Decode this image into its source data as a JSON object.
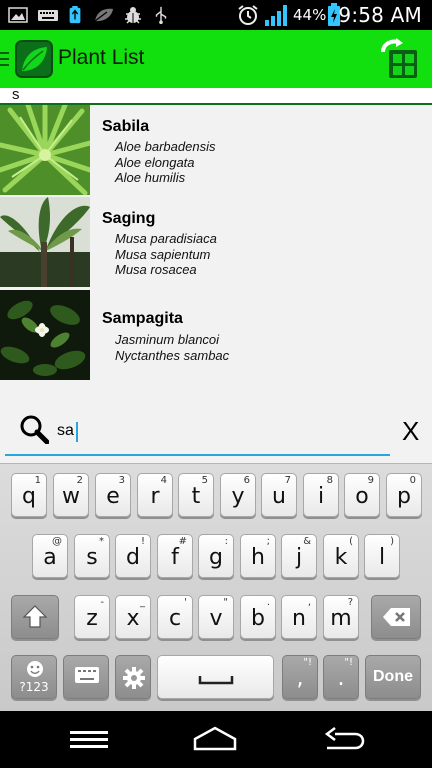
{
  "status_bar": {
    "battery_percent": "44%",
    "time": "9:58 AM",
    "icons": [
      "image-icon",
      "keyboard-icon",
      "usb-battery-icon",
      "leaf-icon",
      "bug-icon",
      "usb-icon",
      "alarm-icon",
      "signal-icon",
      "battery-charging-icon"
    ]
  },
  "action_bar": {
    "title": "Plant List"
  },
  "section": {
    "header": "s"
  },
  "plants": [
    {
      "name": "Sabila",
      "scientific": [
        "Aloe barbadensis",
        "Aloe elongata",
        "Aloe humilis"
      ]
    },
    {
      "name": "Saging",
      "scientific": [
        "Musa paradisiaca",
        "Musa sapientum",
        "Musa rosacea"
      ]
    },
    {
      "name": "Sampagita",
      "scientific": [
        "Jasminum blancoi",
        "Nyctanthes sambac"
      ]
    }
  ],
  "search": {
    "value": "sa",
    "clear_label": "X"
  },
  "keyboard": {
    "row1": [
      {
        "key": "q",
        "hint": "1"
      },
      {
        "key": "w",
        "hint": "2"
      },
      {
        "key": "e",
        "hint": "3"
      },
      {
        "key": "r",
        "hint": "4"
      },
      {
        "key": "t",
        "hint": "5"
      },
      {
        "key": "y",
        "hint": "6"
      },
      {
        "key": "u",
        "hint": "7"
      },
      {
        "key": "i",
        "hint": "8"
      },
      {
        "key": "o",
        "hint": "9"
      },
      {
        "key": "p",
        "hint": "0"
      }
    ],
    "row2": [
      {
        "key": "a",
        "hint": "@"
      },
      {
        "key": "s",
        "hint": "*"
      },
      {
        "key": "d",
        "hint": "!"
      },
      {
        "key": "f",
        "hint": "#"
      },
      {
        "key": "g",
        "hint": ":"
      },
      {
        "key": "h",
        "hint": ";"
      },
      {
        "key": "j",
        "hint": "&"
      },
      {
        "key": "k",
        "hint": "("
      },
      {
        "key": "l",
        "hint": ")"
      }
    ],
    "row3": [
      {
        "key": "z",
        "hint": "-"
      },
      {
        "key": "x",
        "hint": "_"
      },
      {
        "key": "c",
        "hint": "'"
      },
      {
        "key": "v",
        "hint": "\""
      },
      {
        "key": "b",
        "hint": "."
      },
      {
        "key": "n",
        "hint": ","
      },
      {
        "key": "m",
        "hint": "?"
      }
    ],
    "symbols_label": "?123",
    "comma": ",",
    "comma_hint": "\"!",
    "period": ".",
    "period_hint": "\"!",
    "done_label": "Done"
  },
  "colors": {
    "action_bar": "#11e00e",
    "accent": "#2aa7d8",
    "dark_green": "#0b6f1a"
  }
}
